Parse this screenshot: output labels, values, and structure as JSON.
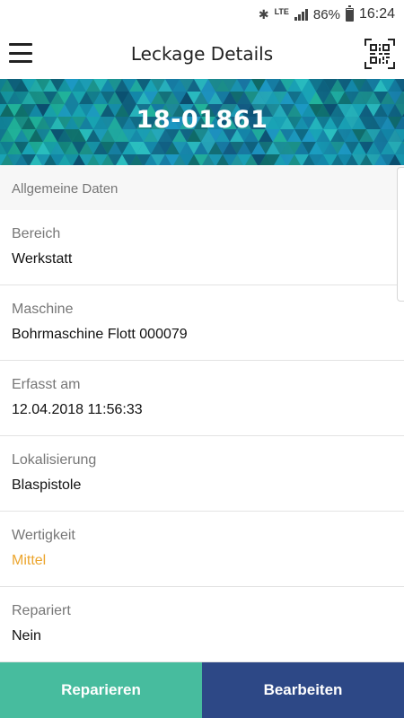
{
  "status_bar": {
    "icons": [
      "bluetooth-icon",
      "lte-icon",
      "signal-icon",
      "battery-icon"
    ],
    "lte": "LTE",
    "battery": "86%",
    "time": "16:24"
  },
  "app_bar": {
    "title": "Leckage Details",
    "left_icon": "hamburger-menu-icon",
    "right_icon": "qr-code-icon"
  },
  "banner": {
    "title": "18-01861"
  },
  "section": {
    "title": "Allgemeine Daten"
  },
  "fields": [
    {
      "label": "Bereich",
      "value": "Werkstatt"
    },
    {
      "label": "Maschine",
      "value": "Bohrmaschine Flott 000079"
    },
    {
      "label": "Erfasst am",
      "value": "12.04.2018 11:56:33"
    },
    {
      "label": "Lokalisierung",
      "value": "Blaspistole"
    },
    {
      "label": "Wertigkeit",
      "value": "Mittel"
    },
    {
      "label": "Repariert",
      "value": "Nein"
    }
  ],
  "colors": {
    "accent_orange": "#eca52d",
    "repair_button": "#47bc9e",
    "edit_button": "#2d4886"
  },
  "buttons": {
    "repair": "Reparieren",
    "edit": "Bearbeiten"
  }
}
